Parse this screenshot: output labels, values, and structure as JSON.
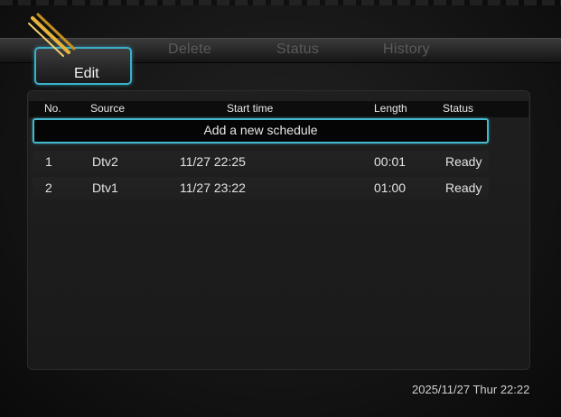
{
  "tabs": {
    "edit": "Edit",
    "delete": "Delete",
    "status": "Status",
    "history": "History"
  },
  "table": {
    "headers": {
      "no": "No.",
      "source": "Source",
      "start_time": "Start time",
      "length": "Length",
      "status": "Status"
    },
    "add_label": "Add a new schedule",
    "rows": [
      {
        "no": "1",
        "source": "Dtv2",
        "start_time": "11/27 22:25",
        "length": "00:01",
        "status": "Ready"
      },
      {
        "no": "2",
        "source": "Dtv1",
        "start_time": "11/27 23:22",
        "length": "01:00",
        "status": "Ready"
      }
    ]
  },
  "footer": {
    "datetime": "2025/11/27 Thur 22:22"
  },
  "icons": {
    "tab_edit_icon": "pen-icon"
  },
  "colors": {
    "accent": "#43b9d0",
    "pen_yellow": "#e6b43a"
  }
}
